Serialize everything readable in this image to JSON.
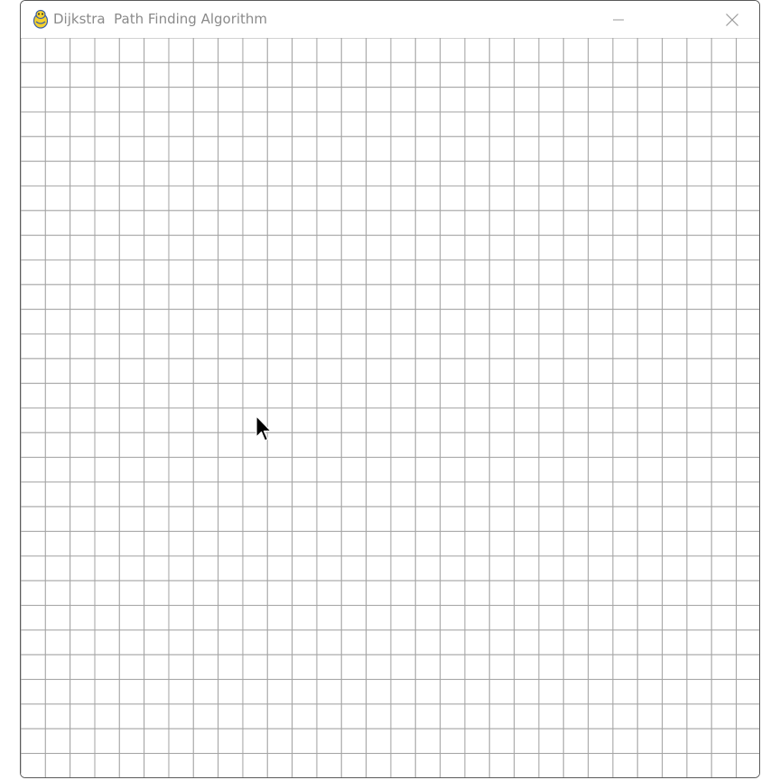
{
  "window": {
    "title": "Dijkstra  Path Finding Algorithm",
    "app_icon": "pygame-snake-icon",
    "controls": [
      "minimize-icon",
      "close-icon"
    ]
  },
  "grid": {
    "rows": 30,
    "cols": 30,
    "line_color": "#a4a4a4",
    "background_color": "#ffffff"
  },
  "cursor": {
    "icon": "arrow-pointer-icon"
  }
}
